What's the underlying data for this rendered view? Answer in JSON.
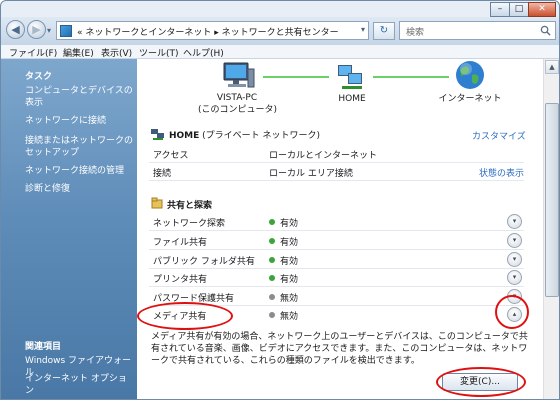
{
  "titlebar": {
    "buttons": {
      "minimize": "–",
      "maximize": "□",
      "close": "✕"
    }
  },
  "navbar": {
    "back_glyph": "◀",
    "forward_glyph": "▶",
    "address_text": "« ネットワークとインターネット ▸ ネットワークと共有センター",
    "refresh_glyph": "↻",
    "search_placeholder": "検索",
    "icons": {
      "address": "network-folder-icon",
      "search": "magnifier-icon"
    }
  },
  "menubar": {
    "items": [
      "ファイル(F)",
      "編集(E)",
      "表示(V)",
      "ツール(T)",
      "ヘルプ(H)"
    ]
  },
  "sidebar": {
    "task_heading": "タスク",
    "tasks": [
      "コンピュータとデバイスの表示",
      "ネットワークに接続",
      "接続またはネットワークのセットアップ",
      "ネットワーク接続の管理",
      "診断と修復"
    ],
    "related_heading": "関連項目",
    "related": [
      "Windows ファイアウォール",
      "インターネット オプション"
    ]
  },
  "network_map": {
    "nodes": [
      {
        "label": "VISTA-PC",
        "sublabel": "(このコンピュータ)",
        "icon": "computer-icon"
      },
      {
        "label": "HOME",
        "sublabel": "",
        "icon": "network-icon"
      },
      {
        "label": "インターネット",
        "sublabel": "",
        "icon": "globe-icon"
      }
    ]
  },
  "network_info": {
    "title": "HOME",
    "type": "(プライベート ネットワーク)",
    "customize_link": "カスタマイズ",
    "rows": [
      {
        "label": "アクセス",
        "value": "ローカルとインターネット",
        "link": ""
      },
      {
        "label": "接続",
        "value": "ローカル エリア接続",
        "link": "状態の表示"
      }
    ]
  },
  "sharing": {
    "heading": "共有と探索",
    "rows": [
      {
        "label": "ネットワーク探索",
        "status": "有効",
        "status_color": "#3aa53a",
        "expander": "▾"
      },
      {
        "label": "ファイル共有",
        "status": "有効",
        "status_color": "#3aa53a",
        "expander": "▾"
      },
      {
        "label": "パブリック フォルダ共有",
        "status": "有効",
        "status_color": "#3aa53a",
        "expander": "▾"
      },
      {
        "label": "プリンタ共有",
        "status": "有効",
        "status_color": "#3aa53a",
        "expander": "▾"
      },
      {
        "label": "パスワード保護共有",
        "status": "無効",
        "status_color": "#8c8c8c",
        "expander": "▾"
      },
      {
        "label": "メディア共有",
        "status": "無効",
        "status_color": "#8c8c8c",
        "expander": "▴"
      }
    ],
    "media_description": "メディア共有が有効の場合、ネットワーク上のユーザーとデバイスは、このコンピュータで共有されている音楽、画像、ビデオにアクセスできます。また、このコンピュータは、ネットワークで共有されている、これらの種類のファイルを検出できます。",
    "change_button": "変更(C)..."
  },
  "colors": {
    "sidebar_text": "#ffffff",
    "link": "#2b6cc4",
    "highlight_circle": "#e01010",
    "connector_line": "#6ad06a"
  }
}
